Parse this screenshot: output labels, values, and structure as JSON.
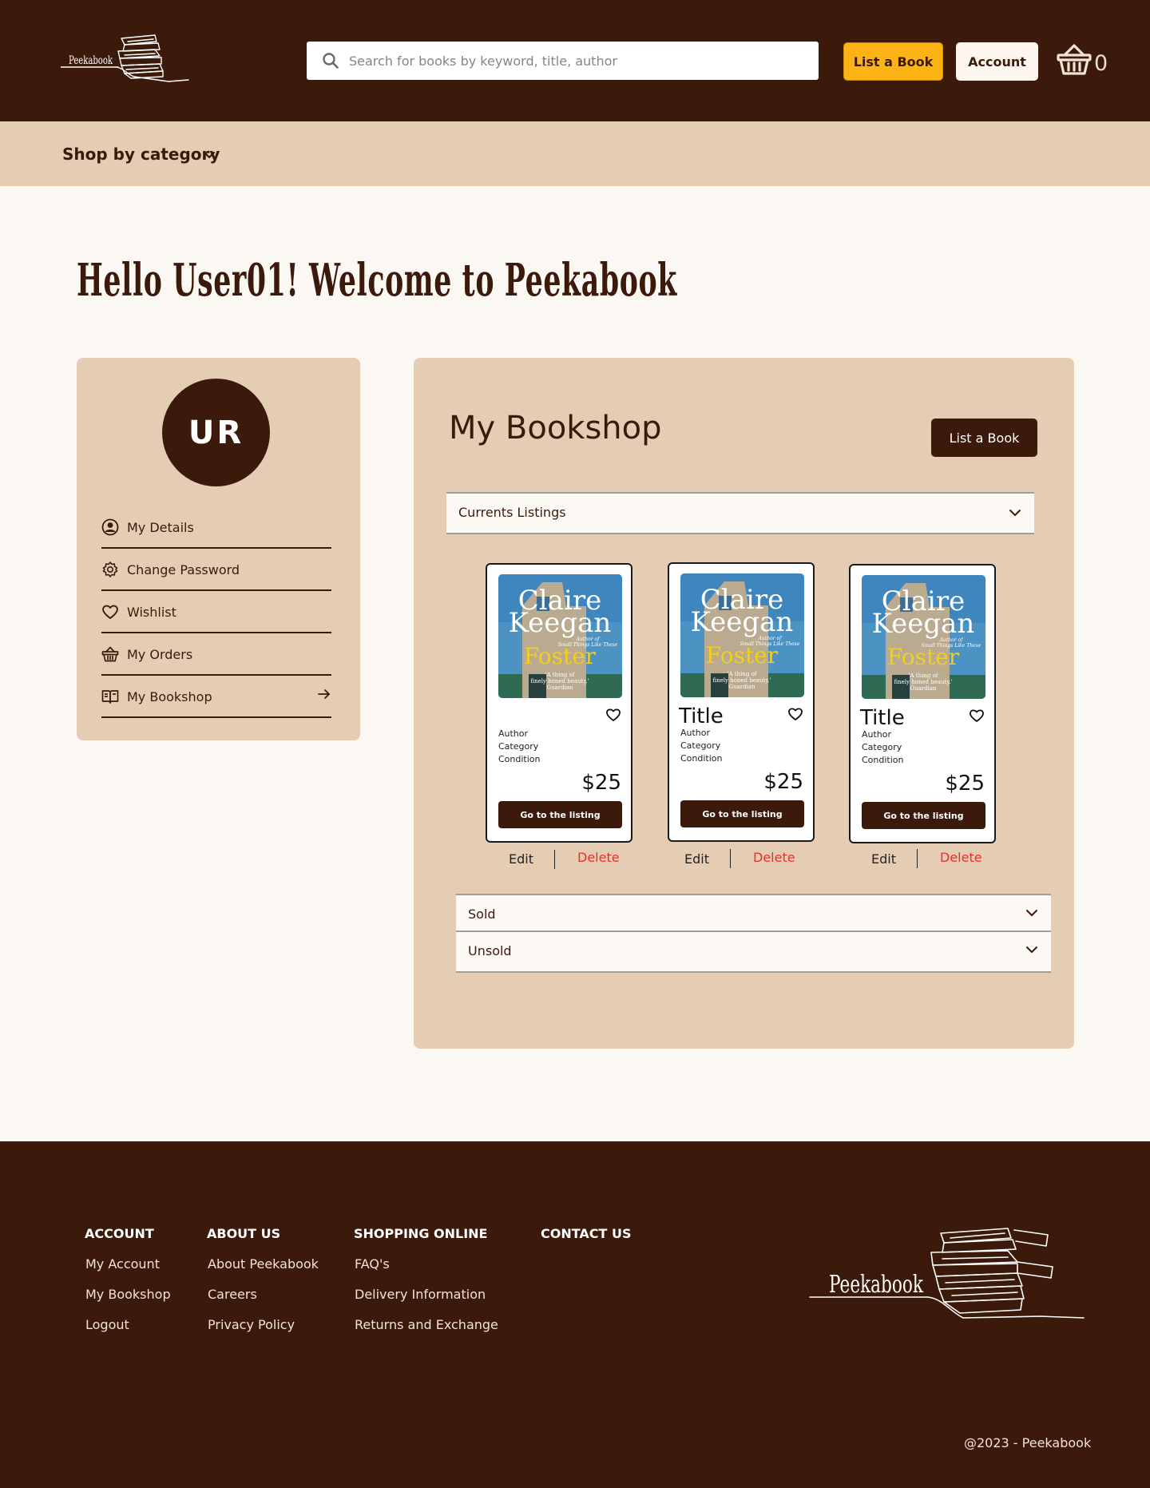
{
  "header": {
    "logo_text": "Peekabook",
    "search_placeholder": "Search for books by keyword, title, author",
    "list_book_label": "List a Book",
    "account_label": "Account",
    "cart_count": "0"
  },
  "category_bar": {
    "label": "Shop by category"
  },
  "greeting": "Hello User01! Welcome to Peekabook",
  "sidebar": {
    "avatar_initials": "UR",
    "items": [
      {
        "label": "My Details",
        "icon": "user-circle-icon"
      },
      {
        "label": "Change Password",
        "icon": "gear-icon"
      },
      {
        "label": "Wishlist",
        "icon": "heart-icon"
      },
      {
        "label": "My Orders",
        "icon": "basket-icon"
      },
      {
        "label": "My Bookshop",
        "icon": "open-book-icon"
      }
    ]
  },
  "bookshop": {
    "title": "My Bookshop",
    "list_book_label": "List a Book",
    "current_listings_label": "Currents Listings",
    "sold_label": "Sold",
    "unsold_label": "Unsold",
    "edit_label": "Edit",
    "delete_label": "Delete",
    "cover": {
      "author": "Claire Keegan",
      "author_line1": "Claire",
      "author_line2": "Keegan",
      "title": "Foster",
      "tagline1": "Author of",
      "tagline2": "Small Things Like These",
      "quote1": "'A thing of",
      "quote2": "finely honed beauty.'",
      "quote3": "Guardian"
    },
    "listings": [
      {
        "title": "",
        "author": "Author",
        "category": "Category",
        "condition": "Condition",
        "price": "$25",
        "button": "Go to the listing"
      },
      {
        "title": "Title",
        "author": "Author",
        "category": "Category",
        "condition": "Condition",
        "price": "$25",
        "button": "Go to the listing"
      },
      {
        "title": "Title",
        "author": "Author",
        "category": "Category",
        "condition": "Condition",
        "price": "$25",
        "button": "Go to the listing"
      }
    ]
  },
  "footer": {
    "columns": [
      {
        "heading": "ACCOUNT",
        "links": [
          "My Account",
          "My Bookshop",
          "Logout"
        ]
      },
      {
        "heading": "ABOUT US",
        "links": [
          "About Peekabook",
          "Careers",
          "Privacy Policy"
        ]
      },
      {
        "heading": "SHOPPING ONLINE",
        "links": [
          "FAQ's",
          "Delivery Information",
          "Returns and Exchange"
        ]
      },
      {
        "heading": "CONTACT US",
        "links": []
      }
    ],
    "logo_text": "Peekabook",
    "copyright": "@2023 - Peekabook"
  },
  "colors": {
    "brand_brown": "#3b1a0b",
    "tan": "#e5cdb4",
    "accent_yellow": "#fbb316",
    "delete_red": "#ef2b2b",
    "background": "#fbf7f2"
  }
}
